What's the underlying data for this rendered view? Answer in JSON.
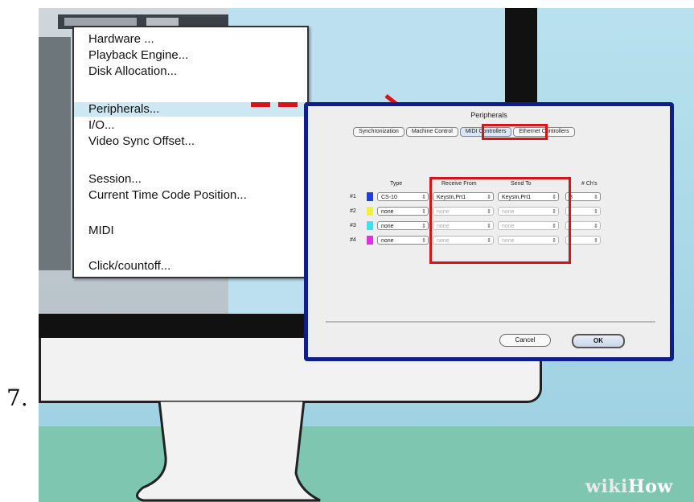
{
  "step_number": "7.",
  "menu": {
    "items": [
      "Hardware ...",
      "Playback Engine...",
      "Disk Allocation...",
      "Peripherals...",
      "I/O...",
      "Video Sync Offset...",
      "Session...",
      "Current Time Code Position...",
      "MIDI",
      "Click/countoff..."
    ],
    "highlighted": "Peripherals..."
  },
  "dialog": {
    "title": "Peripherals",
    "tabs": [
      "Synchronization",
      "Machine Control",
      "MIDI Controllers",
      "Ethernet Controllers"
    ],
    "active_tab": "MIDI Controllers",
    "columns": [
      "Type",
      "Receive From",
      "Send To",
      "# Ch's"
    ],
    "rows": [
      {
        "num": "#1",
        "type": "CS-10",
        "receive": "Keystn,Prt1",
        "send": "Keystn,Prt1",
        "chs": "8",
        "color": "#1f3fd8"
      },
      {
        "num": "#2",
        "type": "none",
        "receive": "none",
        "send": "none",
        "chs": "",
        "color": "#f5f040"
      },
      {
        "num": "#3",
        "type": "none",
        "receive": "none",
        "send": "none",
        "chs": "",
        "color": "#3fe0f0"
      },
      {
        "num": "#4",
        "type": "none",
        "receive": "none",
        "send": "none",
        "chs": "",
        "color": "#e02fe0"
      }
    ],
    "cancel_label": "Cancel",
    "ok_label": "OK"
  },
  "logo": {
    "wiki": "wiki",
    "how": "How"
  },
  "colors": {
    "highlight_red": "#d8141b",
    "dialog_border": "#0f1e8a"
  }
}
